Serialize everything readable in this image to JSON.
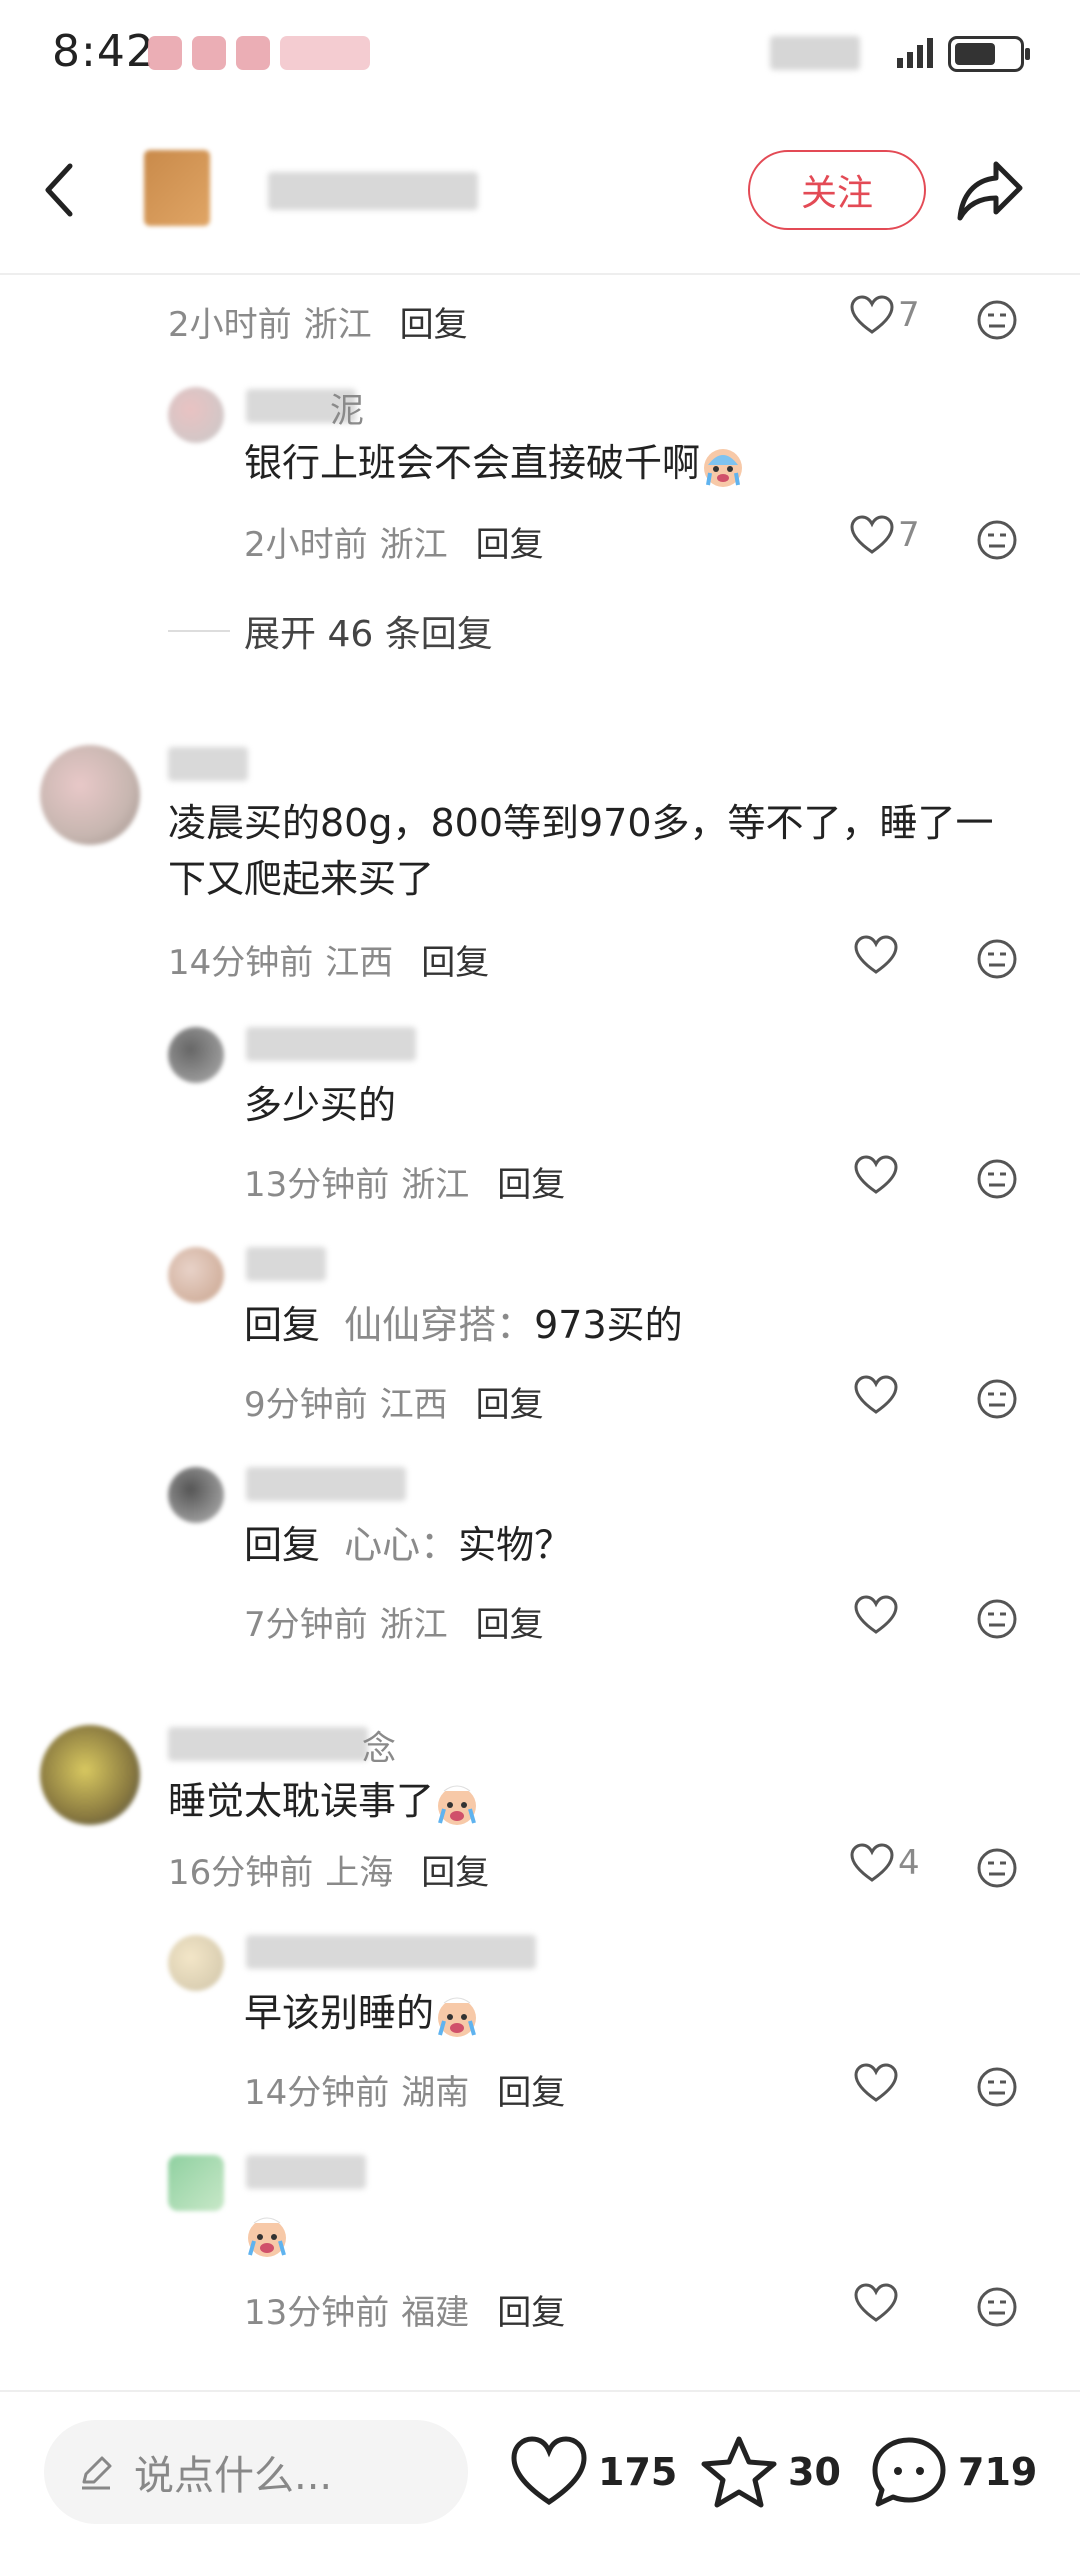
{
  "status_bar": {
    "time": "8:42"
  },
  "header": {
    "follow_label": "关注"
  },
  "comments": {
    "reply_label": "回复",
    "item1": {
      "time": "2小时前",
      "location": "浙江",
      "likes": "7"
    },
    "item2": {
      "name_tail": "泥",
      "text": "银行上班会不会直接破千啊",
      "time": "2小时前",
      "location": "浙江",
      "likes": "7"
    },
    "expand_label": "展开 46 条回复",
    "item3": {
      "text": "凌晨买的80g，800等到970多，等不了，睡了一下又爬起来买了",
      "time": "14分钟前",
      "location": "江西"
    },
    "item4": {
      "text": "多少买的",
      "time": "13分钟前",
      "location": "浙江"
    },
    "item5": {
      "reply_prefix": "回复",
      "mention": "仙仙穿搭：",
      "text": "973买的",
      "time": "9分钟前",
      "location": "江西"
    },
    "item6": {
      "reply_prefix": "回复",
      "mention": "心心：",
      "text": "实物？",
      "time": "7分钟前",
      "location": "浙江"
    },
    "item7": {
      "name_tail": "念",
      "text": "睡觉太耽误事了",
      "time": "16分钟前",
      "location": "上海",
      "likes": "4"
    },
    "item8": {
      "text": "早该别睡的",
      "time": "14分钟前",
      "location": "湖南"
    },
    "item9": {
      "time": "13分钟前",
      "location": "福建"
    }
  },
  "bottom_bar": {
    "input_placeholder": "说点什么...",
    "likes_count": "175",
    "favorites_count": "30",
    "comments_count": "719"
  },
  "colors": {
    "accent": "#e34a55",
    "muted_text": "#8a8a8a"
  }
}
